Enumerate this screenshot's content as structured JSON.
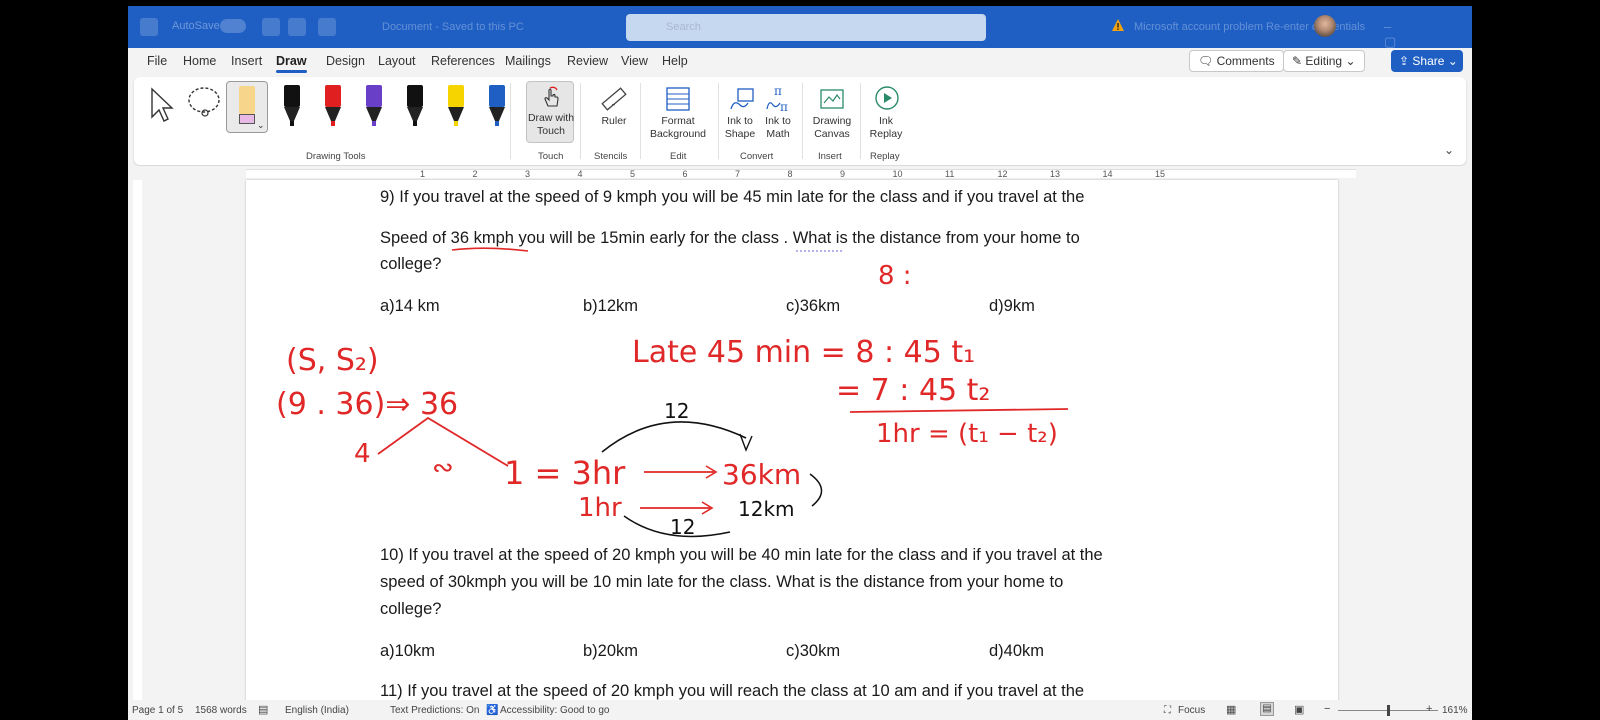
{
  "titlebar": {
    "autosave_label": "AutoSave",
    "autosave_state": "Off",
    "document_title": "Document - Saved to this PC",
    "search_placeholder": "Search",
    "warning_text": "Microsoft account problem  Re-enter credentials",
    "window_controls": "–  ▢  ✕"
  },
  "menu": {
    "tabs": [
      "File",
      "Home",
      "Insert",
      "Draw",
      "Design",
      "Layout",
      "References",
      "Mailings",
      "Review",
      "View",
      "Help"
    ],
    "active_tab": "Draw",
    "comments_label": "Comments",
    "editing_label": "Editing",
    "share_label": "Share"
  },
  "ribbon": {
    "draw_with_touch": "Draw with\nTouch",
    "ruler": "Ruler",
    "format_background": "Format\nBackground",
    "ink_to_shape": "Ink to\nShape",
    "ink_to_math": "Ink to\nMath",
    "drawing_canvas": "Drawing\nCanvas",
    "ink_replay": "Ink\nReplay",
    "groups": {
      "drawing_tools": "Drawing Tools",
      "touch": "Touch",
      "stencils": "Stencils",
      "edit": "Edit",
      "convert": "Convert",
      "insert": "Insert",
      "replay": "Replay"
    },
    "pen_colors": [
      "#111111",
      "#e02020",
      "#6a3fc8",
      "#111111",
      "#f5d400",
      "#1f5fc4"
    ]
  },
  "ruler_numbers": [
    "1",
    "2",
    "3",
    "4",
    "5",
    "6",
    "7",
    "8",
    "9",
    "10",
    "11",
    "12",
    "13",
    "14",
    "15"
  ],
  "document": {
    "q9_line1": "9) If you travel at the speed of 9 kmph you will be 45 min late for the class and if you travel at the",
    "q9_line2": "Speed of 36 kmph you will be 15min early for the class . What is the distance from your home to",
    "q9_line3": "college?",
    "q9_options": [
      "a)14 km",
      "b)12km",
      "c)36km",
      "d)9km"
    ],
    "q10_line1": "10) If you travel at the speed of 20 kmph you will be 40 min late for the class and if you travel at the",
    "q10_line2": "speed of 30kmph you will be 10 min late for the class. What is the distance from your home to",
    "q10_line3": "college?",
    "q10_options": [
      "a)10km",
      "b)20km",
      "c)30km",
      "d)40km"
    ],
    "q11_line1": "11) If you travel at the speed of 20 kmph you will reach the class at 10 am and if you travel at the"
  },
  "ink": {
    "color": "#e02828",
    "top_note": "8 :",
    "s_pair": "(S, S₂)",
    "values_pair": "(9 . 36)⇒ 36",
    "ratio_four": "4",
    "ratio_tilde": "∾",
    "late_line": "Late 45 min  =  8 : 45  t₁",
    "early_line": "= 7 : 45  t₂",
    "diff_line": "1hr = (t₁ − t₂)",
    "arc_top_label": "12",
    "arc_bottom_label": "12",
    "eq_row1_left": "1 = 3hr",
    "eq_row1_right": "36km",
    "eq_row2_left": "1hr",
    "eq_row2_right": "12km"
  },
  "status": {
    "page": "Page 1 of 5",
    "words": "1568 words",
    "language": "English (India)",
    "text_predictions": "Text Predictions: On",
    "accessibility": "Accessibility: Good to go",
    "focus": "Focus",
    "zoom": "161%"
  }
}
